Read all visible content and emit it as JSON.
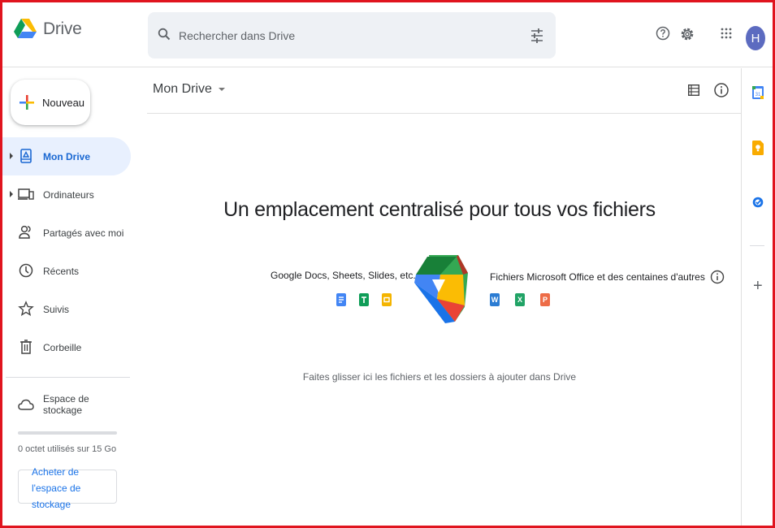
{
  "header": {
    "app_name": "Drive",
    "search_placeholder": "Rechercher dans Drive",
    "avatar_initial": "H"
  },
  "sidebar": {
    "new_label": "Nouveau",
    "items": [
      {
        "label": "Mon Drive",
        "icon": "my-drive-icon",
        "active": true,
        "expandable": true
      },
      {
        "label": "Ordinateurs",
        "icon": "computers-icon",
        "active": false,
        "expandable": true
      },
      {
        "label": "Partagés avec moi",
        "icon": "shared-icon",
        "active": false,
        "expandable": false
      },
      {
        "label": "Récents",
        "icon": "clock-icon",
        "active": false,
        "expandable": false
      },
      {
        "label": "Suivis",
        "icon": "star-icon",
        "active": false,
        "expandable": false
      },
      {
        "label": "Corbeille",
        "icon": "trash-icon",
        "active": false,
        "expandable": false
      }
    ],
    "storage_label": "Espace de stockage",
    "storage_used_fraction": 0,
    "usage_text": "0 octet utilisés sur 15 Go",
    "buy_label": "Acheter de l'espace de stockage"
  },
  "main": {
    "breadcrumb": "Mon Drive",
    "empty_title": "Un emplacement centralisé pour tous vos fichiers",
    "left_caption": "Google Docs, Sheets, Slides, etc.",
    "right_caption": "Fichiers Microsoft Office et des centaines d'autres",
    "office_letters": [
      "W",
      "X",
      "P"
    ],
    "drop_hint": "Faites glisser ici les fichiers et les dossiers à ajouter dans Drive"
  },
  "colors": {
    "accent": "#1a73e8",
    "active_bg": "#e8f0fe",
    "frame": "#e0141e",
    "docs": "#4285f4",
    "sheets": "#0f9d58",
    "slides": "#f4b400",
    "word": "#2b7cd3",
    "excel": "#21a366",
    "powerpoint": "#ed6c47"
  }
}
